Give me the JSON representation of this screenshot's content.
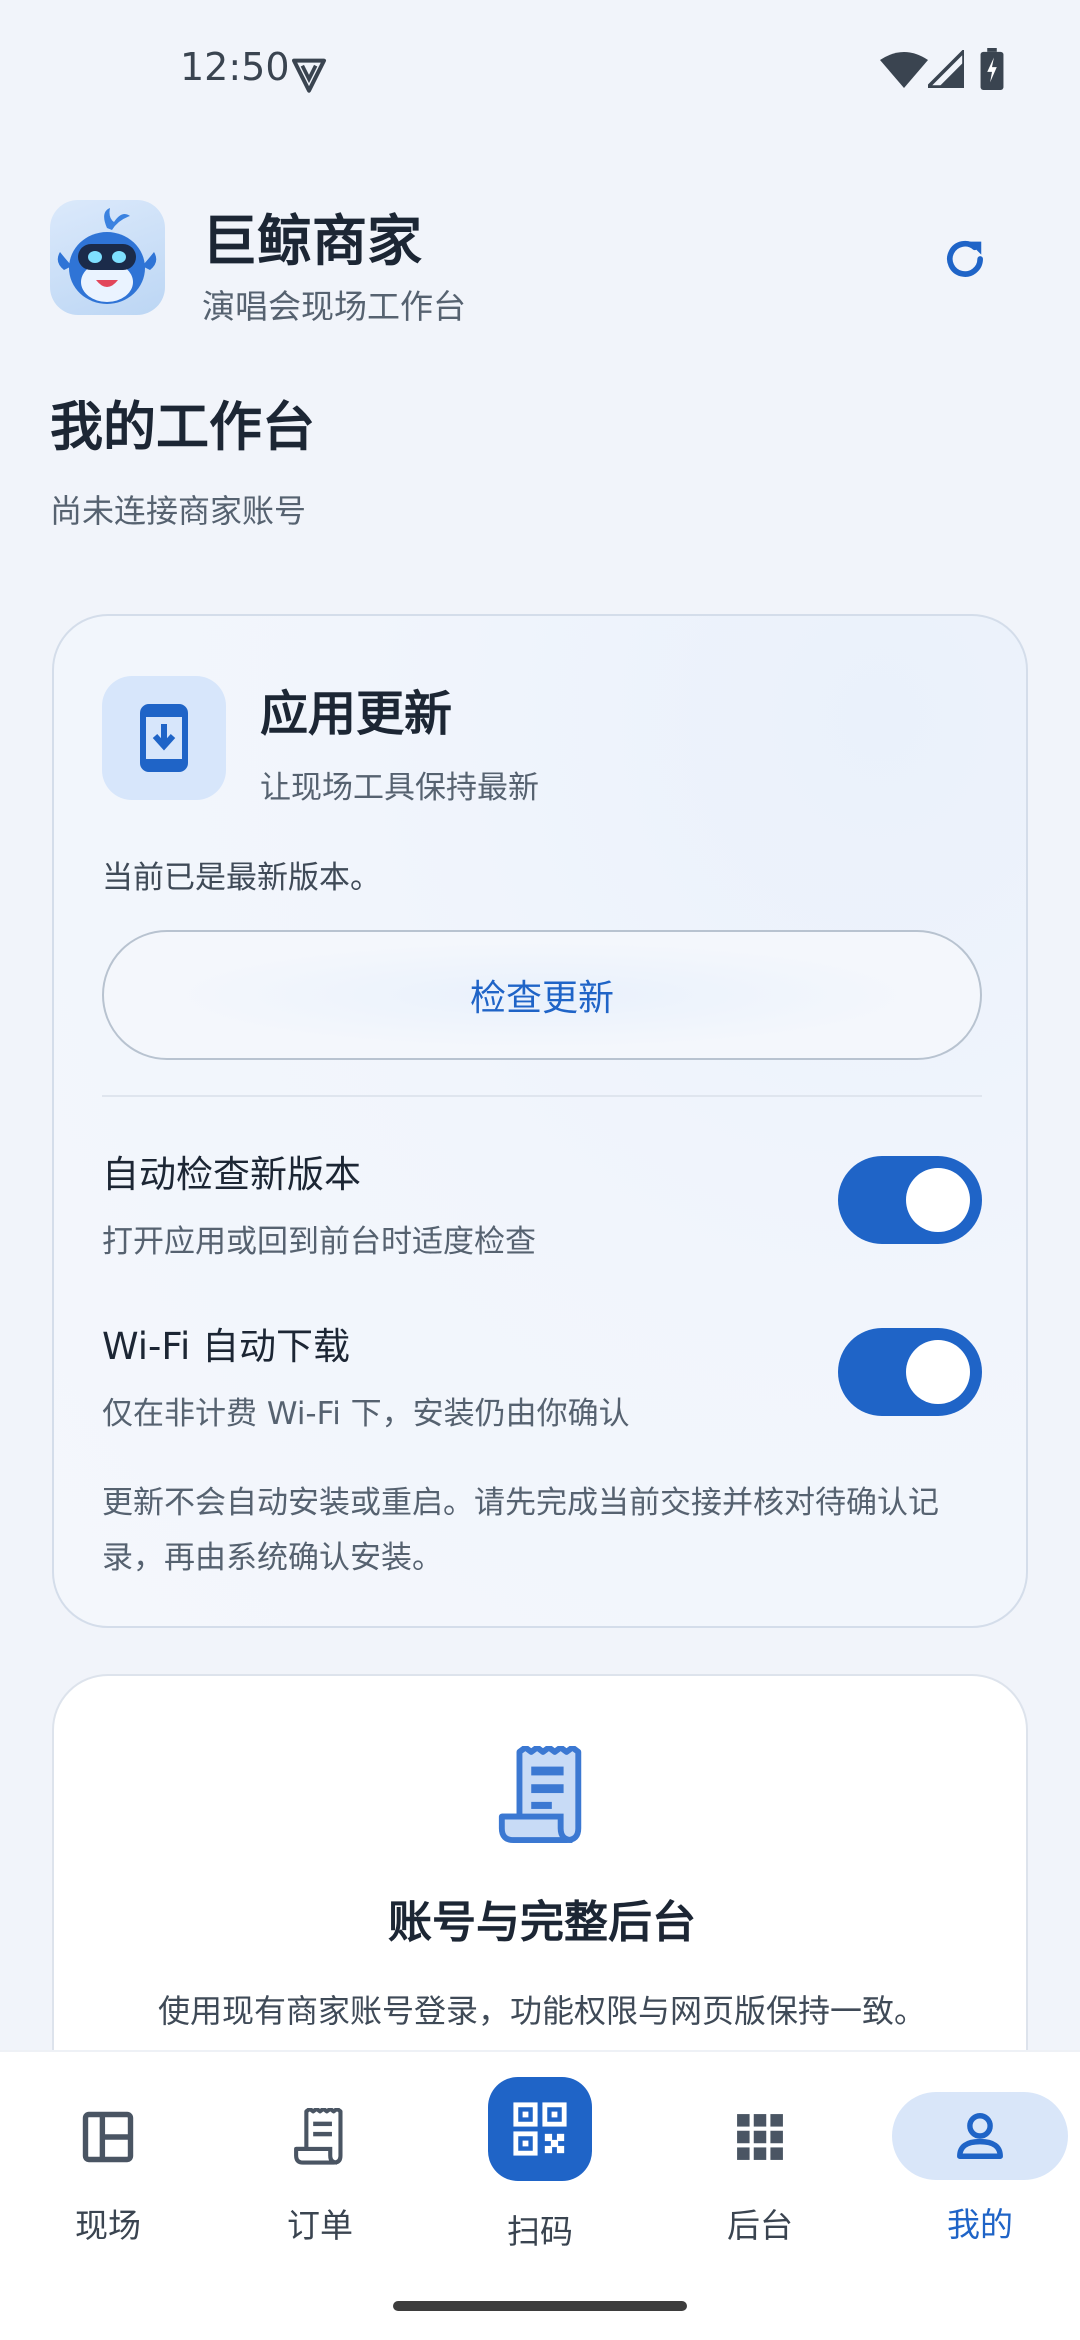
{
  "status_bar": {
    "time": "12:50",
    "icons": [
      "vpn-icon",
      "wifi-icon",
      "signal-icon",
      "battery-charging-icon"
    ]
  },
  "header": {
    "app_name": "巨鲸商家",
    "app_subtitle": "演唱会现场工作台",
    "refresh_icon": "refresh-icon"
  },
  "page": {
    "title": "我的工作台",
    "subtitle": "尚未连接商家账号"
  },
  "update_card": {
    "icon": "phone-download-icon",
    "title": "应用更新",
    "subtitle": "让现场工具保持最新",
    "status": "当前已是最新版本。",
    "check_button": "检查更新",
    "settings": [
      {
        "title": "自动检查新版本",
        "desc": "打开应用或回到前台时适度检查",
        "enabled": true
      },
      {
        "title": "Wi-Fi 自动下载",
        "desc": "仅在非计费 Wi-Fi 下，安装仍由你确认",
        "enabled": true
      }
    ],
    "note": "更新不会自动安装或重启。请先完成当前交接并核对待确认记录，再由系统确认安装。"
  },
  "account_card": {
    "icon": "receipt-icon",
    "title": "账号与完整后台",
    "desc": "使用现有商家账号登录，功能权限与网页版保持一致。"
  },
  "bottom_nav": {
    "items": [
      {
        "label": "现场",
        "icon": "dashboard-icon"
      },
      {
        "label": "订单",
        "icon": "receipt-icon"
      },
      {
        "label": "扫码",
        "icon": "qr-code-icon"
      },
      {
        "label": "后台",
        "icon": "apps-grid-icon"
      },
      {
        "label": "我的",
        "icon": "person-icon"
      }
    ],
    "active_index": 4
  },
  "colors": {
    "accent": "#1f64c7",
    "background": "#f1f4fa",
    "active_pill": "#d9e6f9"
  }
}
